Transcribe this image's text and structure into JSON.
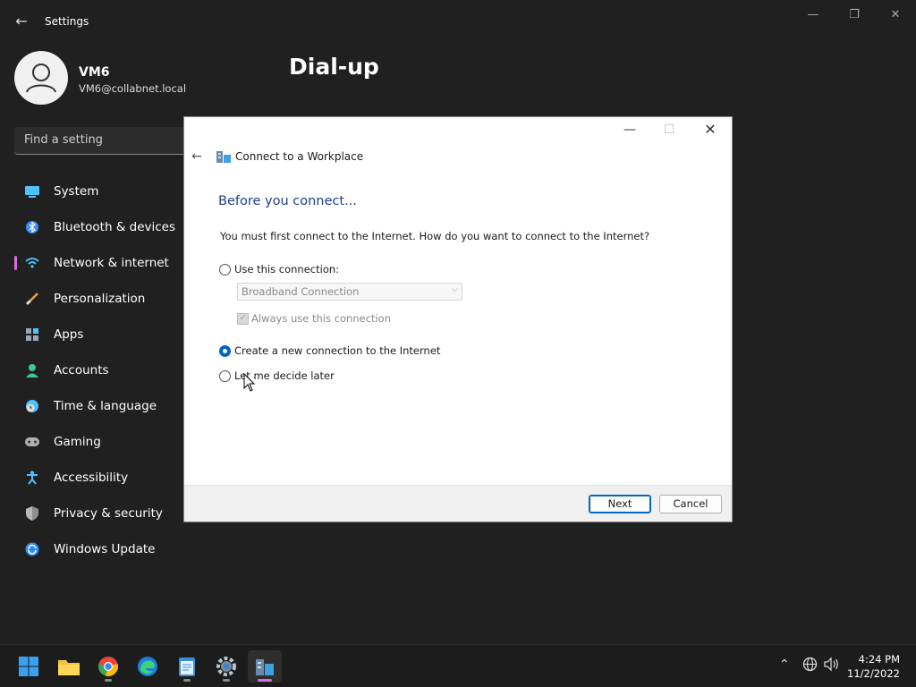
{
  "window": {
    "title": "Settings"
  },
  "user": {
    "name": "VM6",
    "email": "VM6@collabnet.local"
  },
  "search": {
    "placeholder": "Find a setting"
  },
  "nav": [
    {
      "label": "System",
      "icon": "system-icon"
    },
    {
      "label": "Bluetooth & devices",
      "icon": "bluetooth-icon"
    },
    {
      "label": "Network & internet",
      "icon": "wifi-icon",
      "active": true
    },
    {
      "label": "Personalization",
      "icon": "brush-icon"
    },
    {
      "label": "Apps",
      "icon": "apps-icon"
    },
    {
      "label": "Accounts",
      "icon": "person-icon"
    },
    {
      "label": "Time & language",
      "icon": "clock-globe-icon"
    },
    {
      "label": "Gaming",
      "icon": "gamepad-icon"
    },
    {
      "label": "Accessibility",
      "icon": "accessibility-icon"
    },
    {
      "label": "Privacy & security",
      "icon": "shield-icon"
    },
    {
      "label": "Windows Update",
      "icon": "update-icon"
    }
  ],
  "page": {
    "title": "Dial-up"
  },
  "dialog": {
    "title": "Connect to a Workplace",
    "heading": "Before you connect...",
    "question": "You must first connect to the Internet. How do you want to connect to the Internet?",
    "options": {
      "use_connection": "Use this connection:",
      "new_connection": "Create a new connection to the Internet",
      "decide_later": "Let me decide later"
    },
    "selected_option": "new_connection",
    "connection_select": "Broadband Connection",
    "always_use": "Always use this connection",
    "next_label": "Next",
    "cancel_label": "Cancel"
  },
  "taskbar": {
    "apps": [
      "start-icon",
      "file-explorer-icon",
      "chrome-icon",
      "edge-icon",
      "notepad-icon",
      "settings-icon",
      "vpn-connect-icon"
    ],
    "time": "4:24 PM",
    "date": "11/2/2022"
  },
  "colors": {
    "accent": "#d66ee0",
    "dialog_heading": "#1f3f8a",
    "radio_selected": "#0067c0"
  }
}
